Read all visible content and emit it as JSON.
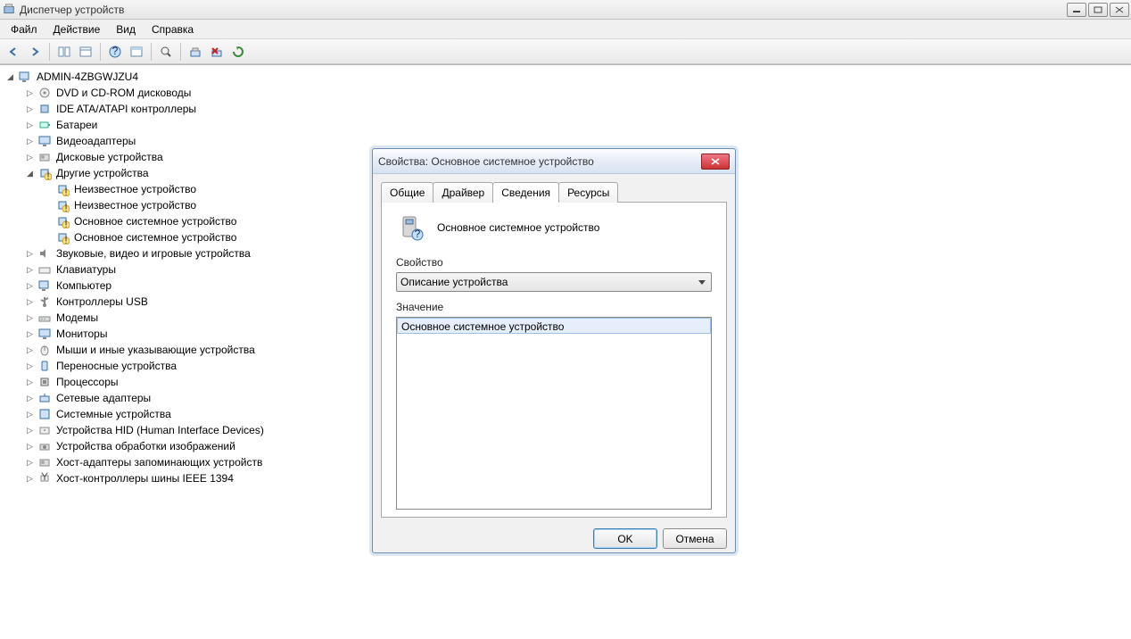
{
  "window": {
    "title": "Диспетчер устройств"
  },
  "menu": {
    "file": "Файл",
    "action": "Действие",
    "view": "Вид",
    "help": "Справка"
  },
  "tree": {
    "root": "ADMIN-4ZBGWJZU4",
    "categories": [
      "DVD и CD-ROM дисководы",
      "IDE ATA/ATAPI контроллеры",
      "Батареи",
      "Видеоадаптеры",
      "Дисковые устройства",
      "Другие устройства",
      "Звуковые, видео и игровые устройства",
      "Клавиатуры",
      "Компьютер",
      "Контроллеры USB",
      "Модемы",
      "Мониторы",
      "Мыши и иные указывающие устройства",
      "Переносные устройства",
      "Процессоры",
      "Сетевые адаптеры",
      "Системные устройства",
      "Устройства HID (Human Interface Devices)",
      "Устройства обработки изображений",
      "Хост-адаптеры запоминающих устройств",
      "Хост-контроллеры шины IEEE 1394"
    ],
    "other_devices_children": [
      "Неизвестное устройство",
      "Неизвестное устройство",
      "Основное системное устройство",
      "Основное системное устройство"
    ]
  },
  "dialog": {
    "title": "Свойства: Основное системное устройство",
    "tabs": {
      "general": "Общие",
      "driver": "Драйвер",
      "details": "Сведения",
      "resources": "Ресурсы"
    },
    "device_name": "Основное системное устройство",
    "property_label": "Свойство",
    "property_value": "Описание устройства",
    "value_label": "Значение",
    "value_item": "Основное системное устройство",
    "ok": "OK",
    "cancel": "Отмена"
  }
}
